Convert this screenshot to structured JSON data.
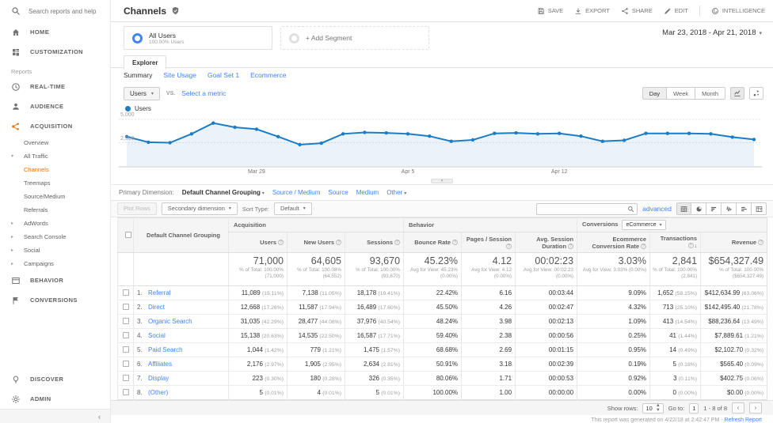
{
  "sidebar": {
    "search_placeholder": "Search reports and help",
    "section_label": "Reports",
    "items_top": [
      {
        "id": "home",
        "icon": "home",
        "label": "HOME"
      },
      {
        "id": "customization",
        "icon": "customization",
        "label": "CUSTOMIZATION"
      }
    ],
    "items_reports": [
      {
        "id": "real-time",
        "icon": "clock",
        "label": "REAL-TIME"
      },
      {
        "id": "audience",
        "icon": "audience",
        "label": "AUDIENCE"
      },
      {
        "id": "acquisition",
        "icon": "acquisition",
        "label": "ACQUISITION",
        "accent": true,
        "children": [
          {
            "label": "Overview"
          },
          {
            "label": "All Traffic",
            "arrow": "down",
            "children": [
              {
                "label": "Channels",
                "active": true
              },
              {
                "label": "Treemaps"
              },
              {
                "label": "Source/Medium"
              },
              {
                "label": "Referrals"
              }
            ]
          },
          {
            "label": "AdWords",
            "arrow": "right"
          },
          {
            "label": "Search Console",
            "arrow": "right"
          },
          {
            "label": "Social",
            "arrow": "right"
          },
          {
            "label": "Campaigns",
            "arrow": "right"
          }
        ]
      },
      {
        "id": "behavior",
        "icon": "behavior",
        "label": "BEHAVIOR"
      },
      {
        "id": "conversions",
        "icon": "flag",
        "label": "CONVERSIONS"
      }
    ],
    "items_bottom": [
      {
        "id": "discover",
        "icon": "bulb",
        "label": "DISCOVER"
      },
      {
        "id": "admin",
        "icon": "gear",
        "label": "ADMIN"
      }
    ]
  },
  "header": {
    "title": "Channels",
    "actions": [
      {
        "id": "save",
        "icon": "save",
        "label": "SAVE"
      },
      {
        "id": "export",
        "icon": "export",
        "label": "EXPORT"
      },
      {
        "id": "share",
        "icon": "share",
        "label": "SHARE"
      },
      {
        "id": "edit",
        "icon": "edit",
        "label": "EDIT"
      },
      {
        "id": "intelligence",
        "icon": "intelligence",
        "label": "INTELLIGENCE",
        "divider_before": true
      }
    ],
    "date_range": "Mar 23, 2018 - Apr 21, 2018"
  },
  "segments": {
    "all_users_label": "All Users",
    "all_users_sub": "100.00% Users",
    "add_label": "+ Add Segment"
  },
  "tabs": {
    "explorer": "Explorer",
    "subtabs": [
      {
        "label": "Summary",
        "active": true
      },
      {
        "label": "Site Usage"
      },
      {
        "label": "Goal Set 1"
      },
      {
        "label": "Ecommerce"
      }
    ]
  },
  "metric_controls": {
    "metric_button": "Users",
    "vs_label": "VS.",
    "select_metric": "Select a metric",
    "granularity": [
      {
        "label": "Day",
        "active": true
      },
      {
        "label": "Week"
      },
      {
        "label": "Month"
      }
    ]
  },
  "chart_data": {
    "type": "line",
    "series_name": "Users",
    "line_color": "#1c7cc5",
    "ymax": 5000,
    "y_ticks": [
      {
        "value": 2500,
        "label": "2,500"
      },
      {
        "value": 5000,
        "label": "5,000"
      }
    ],
    "x_dates": [
      "Mar 23",
      "Mar 24",
      "Mar 25",
      "Mar 26",
      "Mar 27",
      "Mar 28",
      "Mar 29",
      "Mar 30",
      "Mar 31",
      "Apr 1",
      "Apr 2",
      "Apr 3",
      "Apr 4",
      "Apr 5",
      "Apr 6",
      "Apr 7",
      "Apr 8",
      "Apr 9",
      "Apr 10",
      "Apr 11",
      "Apr 12",
      "Apr 13",
      "Apr 14",
      "Apr 15",
      "Apr 16",
      "Apr 17",
      "Apr 18",
      "Apr 19",
      "Apr 20",
      "Apr 21"
    ],
    "values": [
      3150,
      2550,
      2500,
      3450,
      4600,
      4150,
      3950,
      3150,
      2300,
      2450,
      3450,
      3600,
      3550,
      3450,
      3200,
      2650,
      2800,
      3500,
      3550,
      3450,
      3500,
      3200,
      2650,
      2750,
      3500,
      3500,
      3500,
      3450,
      3100,
      2850
    ],
    "x_tick_labels": [
      "Mar 29",
      "Apr 5",
      "Apr 12"
    ],
    "x_tick_indexes": [
      6,
      13,
      20
    ],
    "grid": true,
    "legend_position": "top-left"
  },
  "primary_dimension": {
    "label": "Primary Dimension:",
    "current": "Default Channel Grouping",
    "links": [
      "Source / Medium",
      "Source",
      "Medium"
    ],
    "other": "Other"
  },
  "toolbar": {
    "plot_rows": "Plot Rows",
    "secondary_dimension": "Secondary dimension",
    "sort_type_label": "Sort Type:",
    "sort_type_value": "Default",
    "advanced": "advanced",
    "search_value": "",
    "view_icons": [
      "data-table",
      "percentage",
      "performance",
      "comparison",
      "term-cloud",
      "pivot"
    ]
  },
  "table": {
    "dimension_header": "Default Channel Grouping",
    "groups": [
      {
        "label": "Acquisition",
        "span": 3
      },
      {
        "label": "Behavior",
        "span": 3
      },
      {
        "label": "Conversions",
        "span": 3,
        "selector": "eCommerce"
      }
    ],
    "columns": [
      "Users",
      "New Users",
      "Sessions",
      "Bounce Rate",
      "Pages / Session",
      "Avg. Session Duration",
      "Ecommerce Conversion Rate",
      "Transactions",
      "Revenue"
    ],
    "sorted_column_index": 7,
    "totals": [
      {
        "v": "71,000",
        "sub": "% of Total: 100.00% (71,000)"
      },
      {
        "v": "64,605",
        "sub": "% of Total: 100.08% (64,552)"
      },
      {
        "v": "93,670",
        "sub": "% of Total: 100.00% (93,670)"
      },
      {
        "v": "45.23%",
        "sub": "Avg for View: 45.23% (0.00%)"
      },
      {
        "v": "4.12",
        "sub": "Avg for View: 4.12 (0.00%)"
      },
      {
        "v": "00:02:23",
        "sub": "Avg for View: 00:02:23 (0.00%)"
      },
      {
        "v": "3.03%",
        "sub": "Avg for View: 3.03% (0.00%)"
      },
      {
        "v": "2,841",
        "sub": "% of Total: 100.00% (2,841)"
      },
      {
        "v": "$654,327.49",
        "sub": "% of Total: 100.00% ($654,327.49)"
      }
    ],
    "rows": [
      {
        "rank": "1.",
        "channel": "Referral",
        "cells": [
          [
            "11,089",
            "(15.11%)"
          ],
          [
            "7,138",
            "(11.05%)"
          ],
          [
            "18,178",
            "(19.41%)"
          ],
          "22.42%",
          "6.16",
          "00:03:44",
          "9.09%",
          [
            "1,652",
            "(58.15%)"
          ],
          [
            "$412,634.99",
            "(63.06%)"
          ]
        ]
      },
      {
        "rank": "2.",
        "channel": "Direct",
        "cells": [
          [
            "12,668",
            "(17.26%)"
          ],
          [
            "11,587",
            "(17.94%)"
          ],
          [
            "16,489",
            "(17.60%)"
          ],
          "45.50%",
          "4.26",
          "00:02:47",
          "4.32%",
          [
            "713",
            "(25.10%)"
          ],
          [
            "$142,495.40",
            "(21.78%)"
          ]
        ]
      },
      {
        "rank": "3.",
        "channel": "Organic Search",
        "cells": [
          [
            "31,035",
            "(42.29%)"
          ],
          [
            "28,477",
            "(44.08%)"
          ],
          [
            "37,976",
            "(40.54%)"
          ],
          "48.24%",
          "3.98",
          "00:02:13",
          "1.09%",
          [
            "413",
            "(14.54%)"
          ],
          [
            "$88,236.64",
            "(13.49%)"
          ]
        ]
      },
      {
        "rank": "4.",
        "channel": "Social",
        "cells": [
          [
            "15,138",
            "(20.63%)"
          ],
          [
            "14,535",
            "(22.50%)"
          ],
          [
            "16,587",
            "(17.71%)"
          ],
          "59.40%",
          "2.38",
          "00:00:56",
          "0.25%",
          [
            "41",
            "(1.44%)"
          ],
          [
            "$7,889.61",
            "(1.21%)"
          ]
        ]
      },
      {
        "rank": "5.",
        "channel": "Paid Search",
        "cells": [
          [
            "1,044",
            "(1.42%)"
          ],
          [
            "779",
            "(1.21%)"
          ],
          [
            "1,475",
            "(1.57%)"
          ],
          "68.68%",
          "2.69",
          "00:01:15",
          "0.95%",
          [
            "14",
            "(0.49%)"
          ],
          [
            "$2,102.70",
            "(0.32%)"
          ]
        ]
      },
      {
        "rank": "6.",
        "channel": "Affiliates",
        "cells": [
          [
            "2,176",
            "(2.97%)"
          ],
          [
            "1,905",
            "(2.95%)"
          ],
          [
            "2,634",
            "(2.81%)"
          ],
          "50.91%",
          "3.18",
          "00:02:39",
          "0.19%",
          [
            "5",
            "(0.18%)"
          ],
          [
            "$565.40",
            "(0.09%)"
          ]
        ]
      },
      {
        "rank": "7.",
        "channel": "Display",
        "cells": [
          [
            "223",
            "(0.30%)"
          ],
          [
            "180",
            "(0.28%)"
          ],
          [
            "326",
            "(0.35%)"
          ],
          "80.06%",
          "1.71",
          "00:00:53",
          "0.92%",
          [
            "3",
            "(0.11%)"
          ],
          [
            "$402.75",
            "(0.06%)"
          ]
        ]
      },
      {
        "rank": "8.",
        "channel": "(Other)",
        "cells": [
          [
            "5",
            "(0.01%)"
          ],
          [
            "4",
            "(0.01%)"
          ],
          [
            "5",
            "(0.01%)"
          ],
          "100.00%",
          "1.00",
          "00:00:00",
          "0.00%",
          [
            "0",
            "(0.00%)"
          ],
          [
            "$0.00",
            "(0.00%)"
          ]
        ]
      }
    ]
  },
  "footer": {
    "show_rows_label": "Show rows:",
    "show_rows_value": "10",
    "goto_label": "Go to:",
    "goto_value": "1",
    "range": "1 - 8 of 8",
    "generated_prefix": "This report was generated on 4/22/18 at 2:42:47 PM - ",
    "refresh_label": "Refresh Report"
  }
}
